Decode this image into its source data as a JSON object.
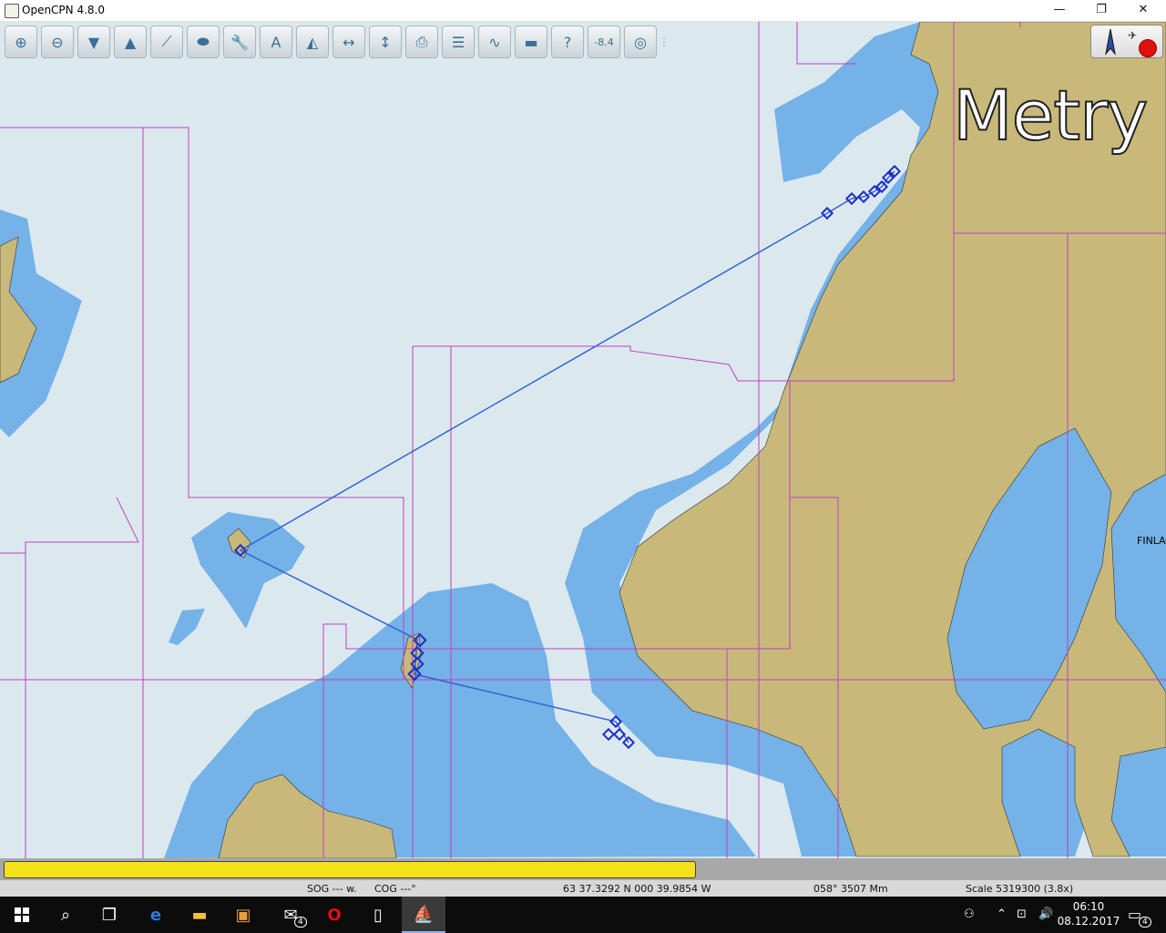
{
  "window": {
    "title": "OpenCPN 4.8.0",
    "minimize_glyph": "—",
    "maximize_glyph": "❐",
    "close_glyph": "✕"
  },
  "toolbar": {
    "tools": [
      {
        "name": "zoom-in",
        "icon": "zoom-in-icon",
        "glyph": "⊕"
      },
      {
        "name": "zoom-out",
        "icon": "zoom-out-icon",
        "glyph": "⊖"
      },
      {
        "name": "scale-in",
        "icon": "scale-in-icon",
        "glyph": "▼"
      },
      {
        "name": "scale-out",
        "icon": "scale-out-icon",
        "glyph": "▲"
      },
      {
        "name": "create-route",
        "icon": "route-icon",
        "glyph": "⟋"
      },
      {
        "name": "auto-follow",
        "icon": "ship-icon",
        "glyph": "⬬"
      },
      {
        "name": "options",
        "icon": "wrench-icon",
        "glyph": "🔧"
      },
      {
        "name": "text",
        "icon": "text-icon",
        "glyph": "A"
      },
      {
        "name": "ais",
        "icon": "ais-icon",
        "glyph": "◭"
      },
      {
        "name": "measure-h",
        "icon": "measure-horizontal-icon",
        "glyph": "↔"
      },
      {
        "name": "measure-v",
        "icon": "measure-vertical-icon",
        "glyph": "↕"
      },
      {
        "name": "print",
        "icon": "printer-icon",
        "glyph": "⎙"
      },
      {
        "name": "route-manager",
        "icon": "route-manager-icon",
        "glyph": "☰"
      },
      {
        "name": "track",
        "icon": "track-icon",
        "glyph": "∿"
      },
      {
        "name": "color-scheme",
        "icon": "color-scheme-icon",
        "glyph": "▬"
      },
      {
        "name": "help",
        "icon": "help-icon",
        "glyph": "?"
      },
      {
        "name": "tide-current",
        "icon": "tide-icon",
        "glyph": "-8.4"
      },
      {
        "name": "mob",
        "icon": "lifebuoy-icon",
        "glyph": "◎"
      }
    ]
  },
  "map": {
    "watermark": "Metry",
    "country_label": "FINLA"
  },
  "status": {
    "sog": "SOG --- w.",
    "cog": "COG ---°",
    "position": "63 37.3292 N   000 39.9854 W",
    "bearing": "058°  3507 Mm",
    "scale": "Scale 5319300 (3.8x)"
  },
  "taskbar": {
    "clock_time": "06:10",
    "clock_date": "08.12.2017",
    "mail_badge": "4",
    "notification_badge": "4"
  },
  "colors": {
    "land": "#c8b97a",
    "shallow": "#74b2e8",
    "deep": "#dbe9ef",
    "chart_outline": "#c040c0",
    "route": "#3264d2",
    "waypoint": "#1f2fc8"
  }
}
